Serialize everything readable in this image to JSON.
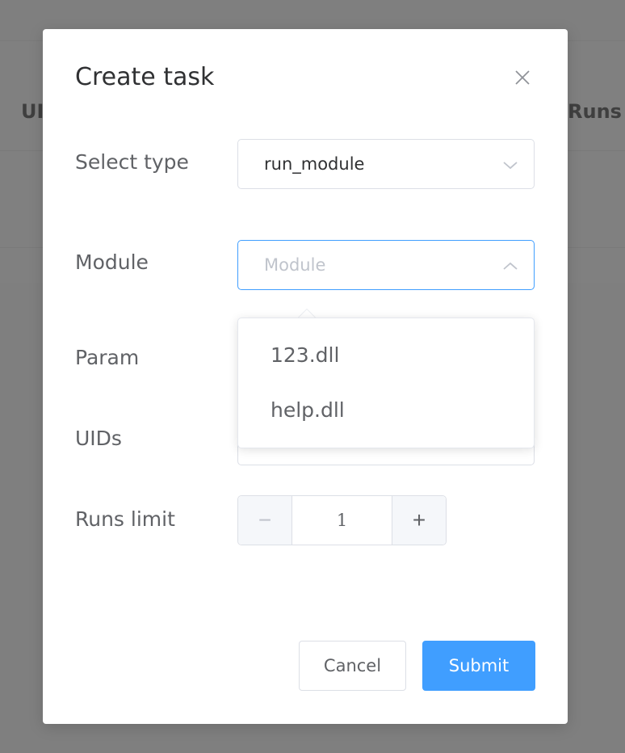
{
  "background": {
    "col_left": "UI",
    "col_right": "Runs"
  },
  "dialog": {
    "title": "Create task",
    "close_icon": "close-icon"
  },
  "form": {
    "select_type": {
      "label": "Select type",
      "value": "run_module"
    },
    "module": {
      "label": "Module",
      "placeholder": "Module",
      "options": [
        "123.dll",
        "help.dll"
      ]
    },
    "param": {
      "label": "Param"
    },
    "uids": {
      "label": "UIDs"
    },
    "runs_limit": {
      "label": "Runs limit",
      "value": "1",
      "minus": "−",
      "plus": "+"
    }
  },
  "footer": {
    "cancel_label": "Cancel",
    "submit_label": "Submit"
  },
  "colors": {
    "primary": "#409eff",
    "overlay": "#7f7f7f",
    "text": "#606266",
    "title": "#303133",
    "border": "#dcdfe6"
  }
}
